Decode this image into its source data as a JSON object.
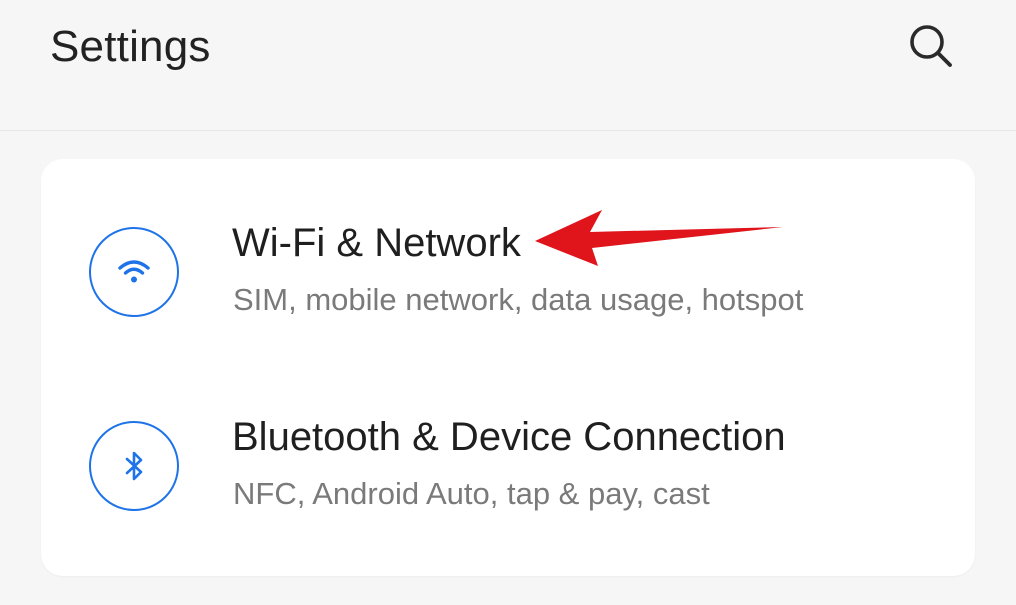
{
  "header": {
    "title": "Settings",
    "search_icon": "search-icon"
  },
  "settings_items": [
    {
      "title": "Wi-Fi & Network",
      "subtitle": "SIM, mobile network, data usage, hotspot",
      "icon": "wifi-icon"
    },
    {
      "title": "Bluetooth & Device Connection",
      "subtitle": "NFC, Android Auto, tap & pay, cast",
      "icon": "bluetooth-icon"
    }
  ],
  "annotation": {
    "type": "arrow",
    "color": "#e0141b",
    "points_to": "Wi-Fi & Network"
  },
  "colors": {
    "accent": "#1e73e8",
    "background": "#f6f6f6",
    "card": "#ffffff",
    "secondary_text": "#7a7a7a"
  }
}
